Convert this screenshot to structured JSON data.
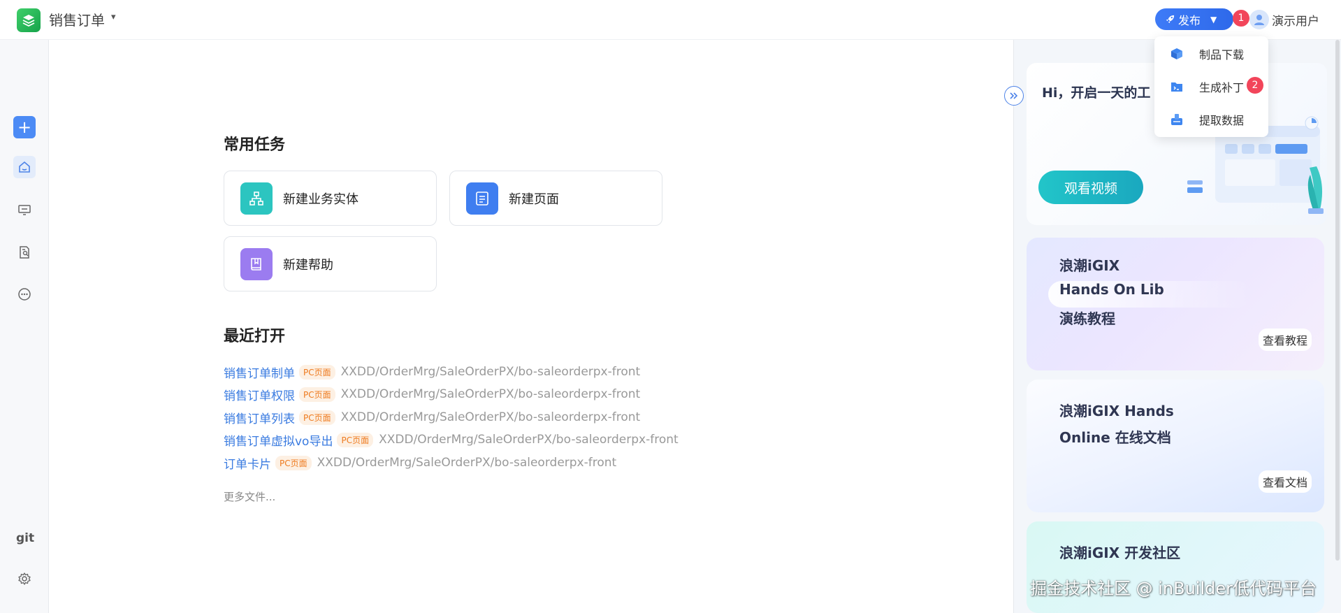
{
  "header": {
    "app_title": "销售订单",
    "app_caret": "▾",
    "publish_label": "发布",
    "publish_caret": "▼",
    "publish_badge": "1",
    "user_name": "演示用户"
  },
  "publish_menu": {
    "items": [
      {
        "label": "制品下载",
        "icon": "box-icon"
      },
      {
        "label": "生成补丁",
        "icon": "terminal-folder-icon",
        "badge": "2"
      },
      {
        "label": "提取数据",
        "icon": "data-tray-icon"
      }
    ]
  },
  "rail": {
    "add": "+",
    "git": "git"
  },
  "main": {
    "common_tasks_title": "常用任务",
    "tasks": [
      {
        "label": "新建业务实体",
        "color": "#2cc5c0"
      },
      {
        "label": "新建页面",
        "color": "#3f7ef0"
      },
      {
        "label": "新建帮助",
        "color": "#9b7cf0"
      }
    ],
    "recent_title": "最近打开",
    "recent": [
      {
        "name": "销售订单制单",
        "tag": "PC页面",
        "path": "XXDD/OrderMrg/SaleOrderPX/bo-saleorderpx-front"
      },
      {
        "name": "销售订单权限",
        "tag": "PC页面",
        "path": "XXDD/OrderMrg/SaleOrderPX/bo-saleorderpx-front"
      },
      {
        "name": "销售订单列表",
        "tag": "PC页面",
        "path": "XXDD/OrderMrg/SaleOrderPX/bo-saleorderpx-front"
      },
      {
        "name": "销售订单虚拟vo导出",
        "tag": "PC页面",
        "path": "XXDD/OrderMrg/SaleOrderPX/bo-saleorderpx-front"
      },
      {
        "name": "订单卡片",
        "tag": "PC页面",
        "path": "XXDD/OrderMrg/SaleOrderPX/bo-saleorderpx-front"
      }
    ],
    "more_files": "更多文件..."
  },
  "right_panel": {
    "greeting": "Hi，开启一天的工",
    "watch_video": "观看视频",
    "promos": [
      {
        "lines": [
          "浪潮iGIX",
          "Hands On Lib",
          "演练教程"
        ],
        "button": "查看教程"
      },
      {
        "lines": [
          "浪潮iGIX Hands",
          "Online 在线文档"
        ],
        "button": "查看文档"
      },
      {
        "lines": [
          "浪潮iGIX 开发社区"
        ]
      }
    ],
    "watermark": "掘金技术社区 @ inBuilder低代码平台"
  },
  "colors": {
    "accent": "#3e7bf7",
    "teal": "#22c5c9",
    "badge": "#f2455a"
  }
}
